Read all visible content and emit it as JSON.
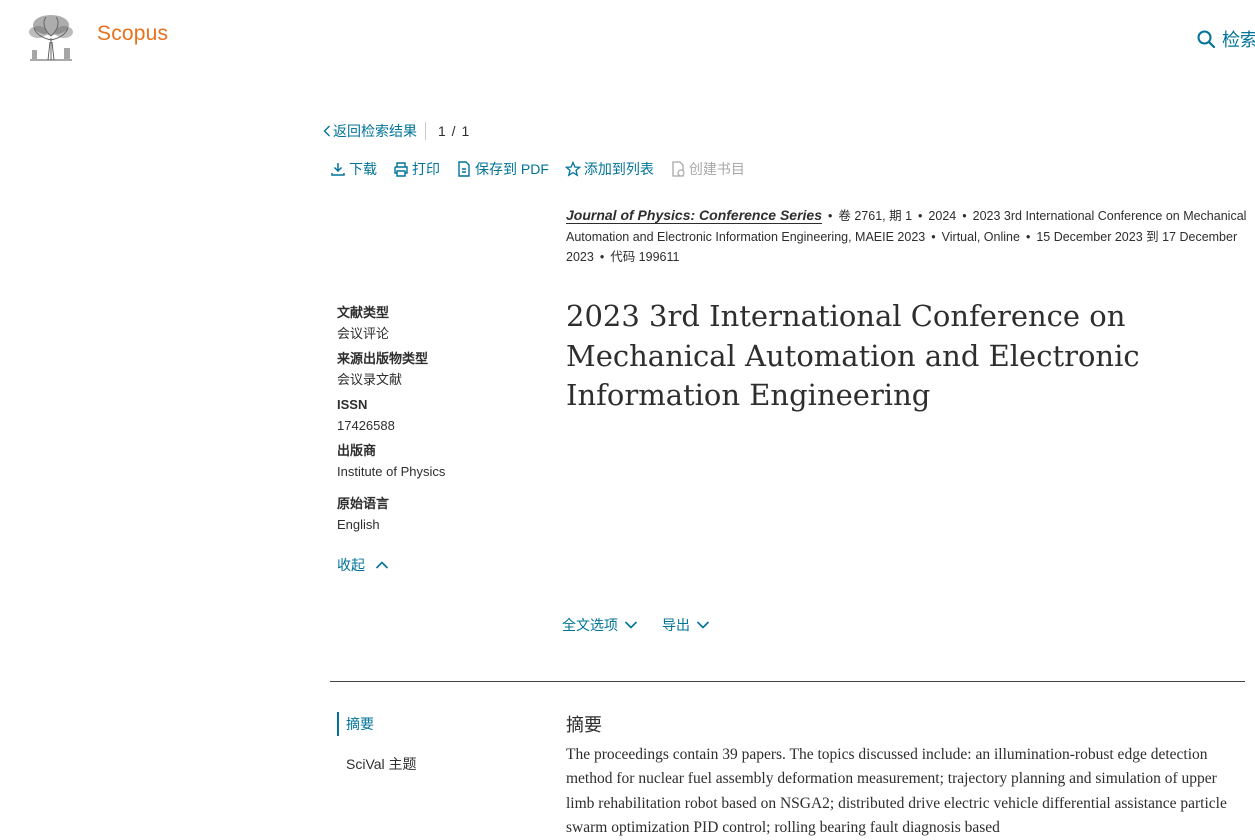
{
  "header": {
    "brand": "Scopus",
    "logo_icon": "elsevier-tree-logo",
    "search_label": "检索"
  },
  "nav": {
    "back_label": "返回检索结果",
    "pager": "1 / 1"
  },
  "toolbar": {
    "download": "下载",
    "print": "打印",
    "save_pdf": "保存到 PDF",
    "add_list": "添加到列表",
    "create_bib": "创建书目"
  },
  "source": {
    "journal": "Journal of Physics: Conference Series",
    "volume_issue": "卷 2761, 期 1",
    "year": "2024",
    "conference": "2023 3rd International Conference on Mechanical Automation and Electronic Information Engineering, MAEIE 2023",
    "location": "Virtual, Online",
    "dates": "15 December 2023 到 17 December 2023",
    "code": "代码 199611"
  },
  "metadata": {
    "doc_type_label": "文献类型",
    "doc_type": "会议评论",
    "source_type_label": "来源出版物类型",
    "source_type": "会议录文献",
    "issn_label": "ISSN",
    "issn": "17426588",
    "publisher_label": "出版商",
    "publisher": "Institute of Physics",
    "language_label": "原始语言",
    "language": "English",
    "collapse_label": "收起"
  },
  "title": "2023 3rd International Conference on Mechanical Automation and Electronic Information Engineering",
  "options": {
    "full_text": "全文选项",
    "export": "导出"
  },
  "sections": {
    "abstract": "摘要",
    "scival": "SciVal 主题"
  },
  "abstract": {
    "heading": "摘要",
    "text": "The proceedings contain 39 papers. The topics discussed include: an illumination-robust edge detection method for nuclear fuel assembly deformation measurement; trajectory planning and simulation of upper limb rehabilitation robot based on NSGA2; distributed drive electric vehicle differential assistance particle swarm optimization PID control; rolling bearing fault diagnosis based"
  },
  "colors": {
    "link": "#007398",
    "brand": "#e9711c",
    "text": "#2e2e2e"
  }
}
